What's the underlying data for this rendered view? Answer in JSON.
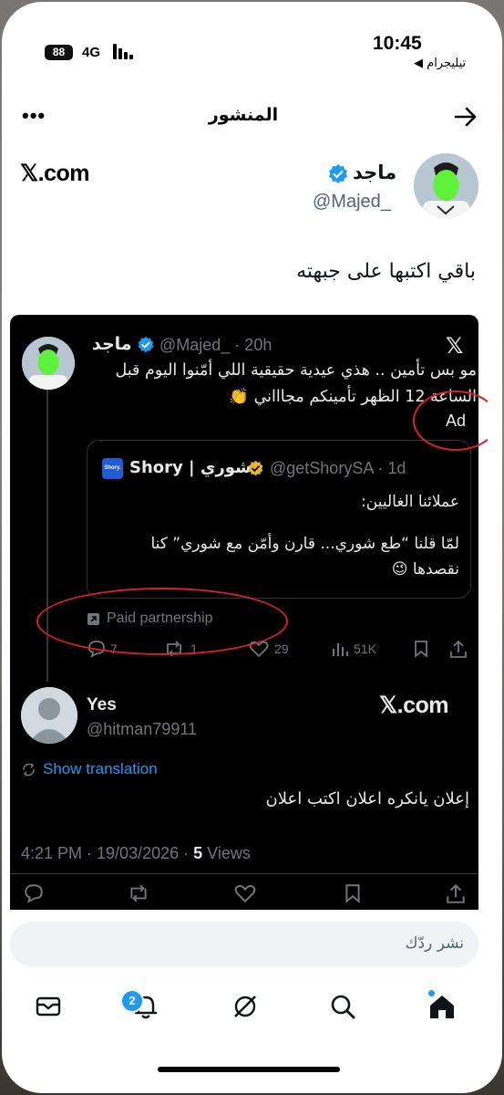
{
  "status_bar": {
    "time": "10:45",
    "back_label": "◀ تيليجرام",
    "battery": "88",
    "network": "4G"
  },
  "nav": {
    "title": "المنشور",
    "more": "•••"
  },
  "post": {
    "author_name": "ماجد",
    "author_handle": "@Majed_",
    "watermark": "𝕏.com",
    "text": "باقي اكتبها على جبهته"
  },
  "screenshot": {
    "tweet": {
      "author_name": "ماجد",
      "handle_time": "@Majed_ · 20h",
      "x_logo": "𝕏",
      "line1": "مو بس تأمين .. هذي عيدية حقيقية اللي أمّنوا اليوم قبل",
      "line2": "الساعة 12 الظهر تأمينكم مجاااني 👏",
      "ad_label": "Ad",
      "quote": {
        "brand_logo": "Shory.",
        "name": "Shory | شوري",
        "handle_time": "@getShorySA · 1d",
        "line1": "عملائنا الغاليين:",
        "line2": "لمّا قلنا “طع شوري... قارن وأمّن مع شوري” كنا",
        "line3": "نقصدها 😉"
      },
      "paid_partnership": "Paid partnership",
      "stats": {
        "replies": "7",
        "reposts": "1",
        "likes": "29",
        "views": "51K"
      }
    },
    "reply": {
      "name": "Yes",
      "handle": "@hitman79911",
      "watermark": "𝕏.com",
      "show_translation": "Show translation",
      "text": "إعلان يانكره اعلان اكتب اعلان",
      "timestamp": "4:21 PM · 19/03/2026 · ",
      "views_count": "5",
      "views_label": " Views"
    }
  },
  "reply_input": {
    "placeholder": "نشر ردّك"
  },
  "tab_bar": {
    "notifications_badge": "2"
  },
  "colors": {
    "accent": "#1d9bf0",
    "annotation": "#d9202a",
    "verified_gold": "#e8b52d"
  }
}
